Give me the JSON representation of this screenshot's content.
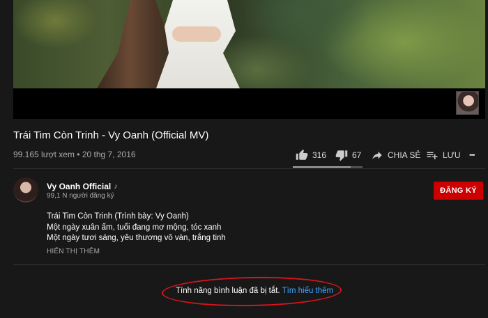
{
  "video": {
    "title": "Trái Tim Còn Trinh - Vy Oanh (Official MV)",
    "views_date": "99.165 lượt xem • 20 thg 7, 2016"
  },
  "actions": {
    "like_count": "316",
    "dislike_count": "67",
    "share_label": "CHIA SẺ",
    "save_label": "LƯU",
    "more_label": "•••",
    "like_ratio": 0.825
  },
  "channel": {
    "name": "Vy Oanh Official",
    "music_badge": "♪",
    "subscribers": "99,1 N người đăng ký",
    "subscribe_label": "ĐĂNG KÝ"
  },
  "description": {
    "lines": [
      "Trái Tim Còn Trinh (Trình bày: Vy Oanh)",
      "Một ngày xuân ấm, tuổi đang mơ mộng, tóc xanh",
      "Một ngày tươi sáng, yêu thương vô vàn, trắng tinh"
    ],
    "show_more": "HIỂN THỊ THÊM"
  },
  "comments": {
    "disabled_text": "Tính năng bình luận đã bị tắt.",
    "learn_more": "Tìm hiểu thêm"
  },
  "colors": {
    "background": "#181818",
    "subscribe": "#cc0000",
    "link": "#3ea6ff",
    "annotation": "#d8141c"
  }
}
